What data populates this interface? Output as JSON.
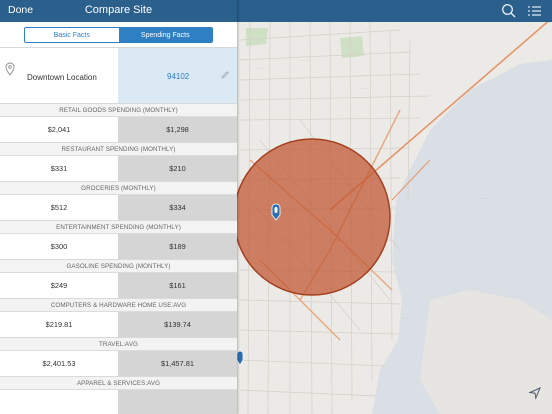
{
  "header": {
    "done_label": "Done",
    "title": "Compare Site"
  },
  "tabs": [
    {
      "label": "Basic Facts",
      "selected": false
    },
    {
      "label": "Spending Facts",
      "selected": true
    }
  ],
  "location": {
    "name": "Downtown Location",
    "zip": "94102"
  },
  "sections": [
    {
      "title": "RETAIL GOODS SPENDING (MONTHLY)",
      "left": "$2,041",
      "right": "$1,298"
    },
    {
      "title": "RESTAURANT SPENDING (MONTHLY)",
      "left": "$331",
      "right": "$210"
    },
    {
      "title": "GROCERIES (MONTHLY)",
      "left": "$512",
      "right": "$334"
    },
    {
      "title": "ENTERTAINMENT SPENDING (MONTHLY)",
      "left": "$300",
      "right": "$189"
    },
    {
      "title": "GASOLINE SPENDING (MONTHLY)",
      "left": "$249",
      "right": "$161"
    },
    {
      "title": "COMPUTERS & HARDWARE HOME USE:AVG",
      "left": "$219.81",
      "right": "$139.74"
    },
    {
      "title": "TRAVEL:AVG",
      "left": "$2,401.53",
      "right": "$1,457.81"
    },
    {
      "title": "APPAREL & SERVICES:AVG",
      "left": "",
      "right": ""
    }
  ],
  "map": {
    "icons": [
      "search-icon",
      "list-icon",
      "navigation-arrow-icon",
      "location-pin-icon"
    ]
  },
  "colors": {
    "header_bg": "#2b5f8c",
    "accent": "#2f7fc4",
    "buffer_fill": "#c0552f",
    "right_column_bg": "#d5d5d5"
  }
}
